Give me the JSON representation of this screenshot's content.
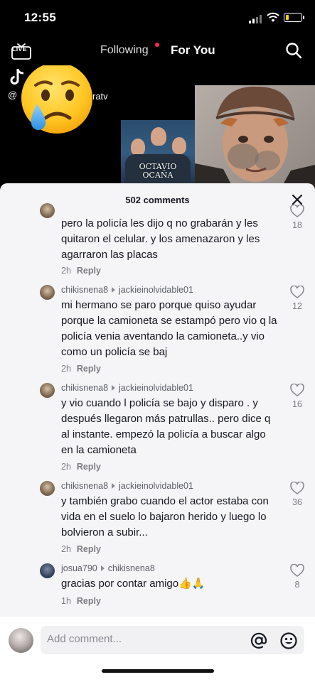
{
  "status_bar": {
    "time": "12:55"
  },
  "top_nav": {
    "live_label": "LIVE",
    "tab_following": "Following",
    "tab_for_you": "For You"
  },
  "video": {
    "handle_prefix": "@",
    "handle_suffix": "ratv",
    "thumbnail_caption_line1": "OCTAVIO",
    "thumbnail_caption_line2": "OCAÑA"
  },
  "comments_panel": {
    "title": "502 comments",
    "comments": [
      {
        "username": "",
        "reply_to": "",
        "text": "pero la policía les dijo q no grabarán y les quitaron el celular. y los amenazaron y les agarraron las placas",
        "time": "2h",
        "reply_label": "Reply",
        "likes": "18"
      },
      {
        "username": "chikisnena8",
        "reply_to": "jackieinolvidable01",
        "text": "mi hermano se paro porque quiso ayudar porque la camioneta se estampó pero vio q la policía venia aventando la camioneta..y vio como un policía se baj",
        "time": "2h",
        "reply_label": "Reply",
        "likes": "12"
      },
      {
        "username": "chikisnena8",
        "reply_to": "jackieinolvidable01",
        "text": "y vio cuando l policía se bajo y disparo . y después llegaron más patrullas.. pero dice q al instante. empezó la policía a buscar algo en la camioneta",
        "time": "2h",
        "reply_label": "Reply",
        "likes": "16"
      },
      {
        "username": "chikisnena8",
        "reply_to": "jackieinolvidable01",
        "text": "y también grabo cuando el actor estaba con vida en el suelo lo bajaron herido y luego lo bolvieron a subir...",
        "time": "2h",
        "reply_label": "Reply",
        "likes": "36"
      },
      {
        "username": "josua790",
        "reply_to": "chikisnena8",
        "text": "gracias por contar amigo👍🙏",
        "time": "1h",
        "reply_label": "Reply",
        "likes": "8"
      }
    ]
  },
  "add_comment": {
    "placeholder": "Add comment..."
  },
  "icons": {
    "live": "live-tv-icon",
    "search": "search-icon",
    "close": "close-icon",
    "like": "heart-outline-icon",
    "mention": "at-icon",
    "emoji_picker": "smiley-icon",
    "overlay_emoji": "crying-face-emoji"
  },
  "colors": {
    "accent_red": "#fe2c55",
    "sheet_bg": "#f5f4f6",
    "text_primary": "#161823",
    "text_secondary": "#7c7d84"
  }
}
